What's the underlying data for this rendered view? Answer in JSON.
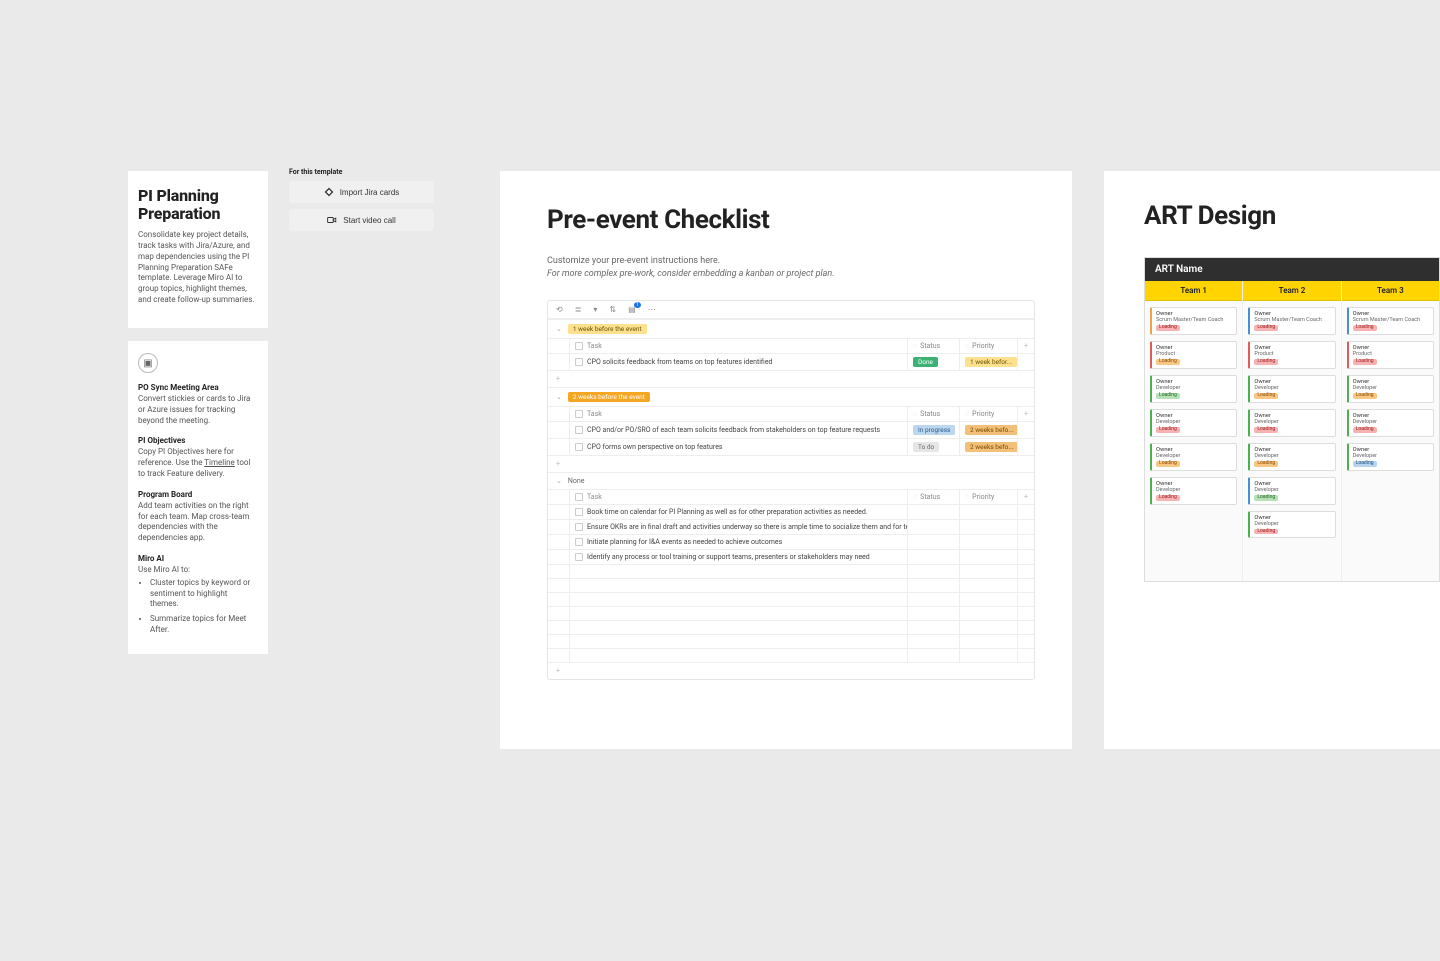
{
  "leftCard": {
    "title": "PI Planning Preparation",
    "body": "Consolidate key project details, track tasks with Jira/Azure, and map dependencies using the PI Planning Preparation SAFe template. Leverage Miro AI to group topics, highlight themes, and create follow-up summaries."
  },
  "guideCard": {
    "s1h": "PO Sync Meeting Area",
    "s1b": "Convert stickies or cards to Jira or Azure issues for tracking beyond the meeting.",
    "s2h": "PI Objectives",
    "s2b_a": "Copy PI Objectives here for reference. Use the ",
    "s2b_link": "Timeline",
    "s2b_b": " tool to track Feature delivery.",
    "s3h": "Program Board",
    "s3b": "Add team activities on the right for each team. Map cross-team dependencies with the dependencies app.",
    "s4h": "Miro AI",
    "s4lead": "Use Miro AI to:",
    "s4i1": "Cluster topics by keyword or sentiment to highlight themes.",
    "s4i2": "Summarize topics for Meet After."
  },
  "actions": {
    "lbl": "For this template",
    "jira": "Import Jira cards",
    "video": "Start video call"
  },
  "checklist": {
    "title": "Pre-event Checklist",
    "sub1": "Customize your pre-event instructions here.",
    "sub2": "For more complex pre-work, consider embedding a kanban or project plan.",
    "cols": {
      "task": "Task",
      "status": "Status",
      "priority": "Priority"
    },
    "sec1": {
      "label": "1 week before the event",
      "rows": [
        {
          "task": "CPO solicits feedback from teams on top features identified",
          "status": "Done",
          "statusCls": "pill-done",
          "priority": "1 week befor...",
          "priorityCls": "pill-yellow"
        }
      ]
    },
    "sec2": {
      "label": "2 weeks before the event",
      "rows": [
        {
          "task": "CPO and/or PO/SRO of each team solicits feedback from stakeholders on top feature requests",
          "status": "In progress",
          "statusCls": "pill-prog",
          "priority": "2 weeks befo...",
          "priorityCls": "pill-orangeL"
        },
        {
          "task": "CPO forms own perspective on top features",
          "status": "To do",
          "statusCls": "pill-todo",
          "priority": "2 weeks befo...",
          "priorityCls": "pill-orangeL"
        }
      ]
    },
    "sec3": {
      "label": "None",
      "rows": [
        {
          "task": "Book time on calendar for PI Planning as well as for other preparation activities as needed.",
          "status": "",
          "statusCls": "",
          "priority": "",
          "priorityCls": ""
        },
        {
          "task": "Ensure OKRs are in final draft and activities underway so there is ample time to socialize them and for teams to draft and revise OKR...",
          "status": "",
          "statusCls": "",
          "priority": "",
          "priorityCls": ""
        },
        {
          "task": "Initiate planning for I&A events as needed to achieve outcomes",
          "status": "",
          "statusCls": "",
          "priority": "",
          "priorityCls": ""
        },
        {
          "task": "Identify any process or tool training or support teams, presenters or stakeholders may need",
          "status": "",
          "statusCls": "",
          "priority": "",
          "priorityCls": ""
        }
      ]
    }
  },
  "art": {
    "title": "ART Design",
    "header": "ART Name",
    "teams": [
      "Team 1",
      "Team 2",
      "Team 3"
    ],
    "cards": {
      "t1": [
        {
          "l1": "Owner",
          "l2": "Scrum Master/Team Coach",
          "tag": "Loading",
          "tagCls": "tag-red",
          "bl": "bl-orange"
        },
        {
          "l1": "Owner",
          "l2": "Product",
          "tag": "Loading",
          "tagCls": "tag-orange",
          "bl": "bl-red"
        },
        {
          "l1": "Owner",
          "l2": "Developer",
          "tag": "Loading",
          "tagCls": "tag-green",
          "bl": "bl-green"
        },
        {
          "l1": "Owner",
          "l2": "Developer",
          "tag": "Loading",
          "tagCls": "tag-red",
          "bl": "bl-green"
        },
        {
          "l1": "Owner",
          "l2": "Developer",
          "tag": "Loading",
          "tagCls": "tag-orange",
          "bl": "bl-green"
        },
        {
          "l1": "Owner",
          "l2": "Developer",
          "tag": "Loading",
          "tagCls": "tag-red",
          "bl": "bl-green"
        }
      ],
      "t2": [
        {
          "l1": "Owner",
          "l2": "Scrum Master/Team Coach",
          "tag": "Loading",
          "tagCls": "tag-red",
          "bl": "bl-blue"
        },
        {
          "l1": "Owner",
          "l2": "Product",
          "tag": "Loading",
          "tagCls": "tag-red",
          "bl": "bl-red"
        },
        {
          "l1": "Owner",
          "l2": "Developer",
          "tag": "Loading",
          "tagCls": "tag-orange",
          "bl": "bl-green"
        },
        {
          "l1": "Owner",
          "l2": "Developer",
          "tag": "Loading",
          "tagCls": "tag-red",
          "bl": "bl-green"
        },
        {
          "l1": "Owner",
          "l2": "Developer",
          "tag": "Loading",
          "tagCls": "tag-orange",
          "bl": "bl-green"
        },
        {
          "l1": "Owner",
          "l2": "Developer",
          "tag": "Loading",
          "tagCls": "tag-green",
          "bl": "bl-blue"
        },
        {
          "l1": "Owner",
          "l2": "Developer",
          "tag": "Loading",
          "tagCls": "tag-red",
          "bl": "bl-green"
        }
      ],
      "t3": [
        {
          "l1": "Owner",
          "l2": "Scrum Master/Team Coach",
          "tag": "Loading",
          "tagCls": "tag-red",
          "bl": "bl-blue"
        },
        {
          "l1": "Owner",
          "l2": "Product",
          "tag": "Loading",
          "tagCls": "tag-red",
          "bl": "bl-red"
        },
        {
          "l1": "Owner",
          "l2": "Developer",
          "tag": "Loading",
          "tagCls": "tag-orange",
          "bl": "bl-green"
        },
        {
          "l1": "Owner",
          "l2": "Developer",
          "tag": "Loading",
          "tagCls": "tag-red",
          "bl": "bl-green"
        },
        {
          "l1": "Owner",
          "l2": "Developer",
          "tag": "Loading",
          "tagCls": "tag-blue",
          "bl": "bl-green"
        }
      ]
    }
  }
}
